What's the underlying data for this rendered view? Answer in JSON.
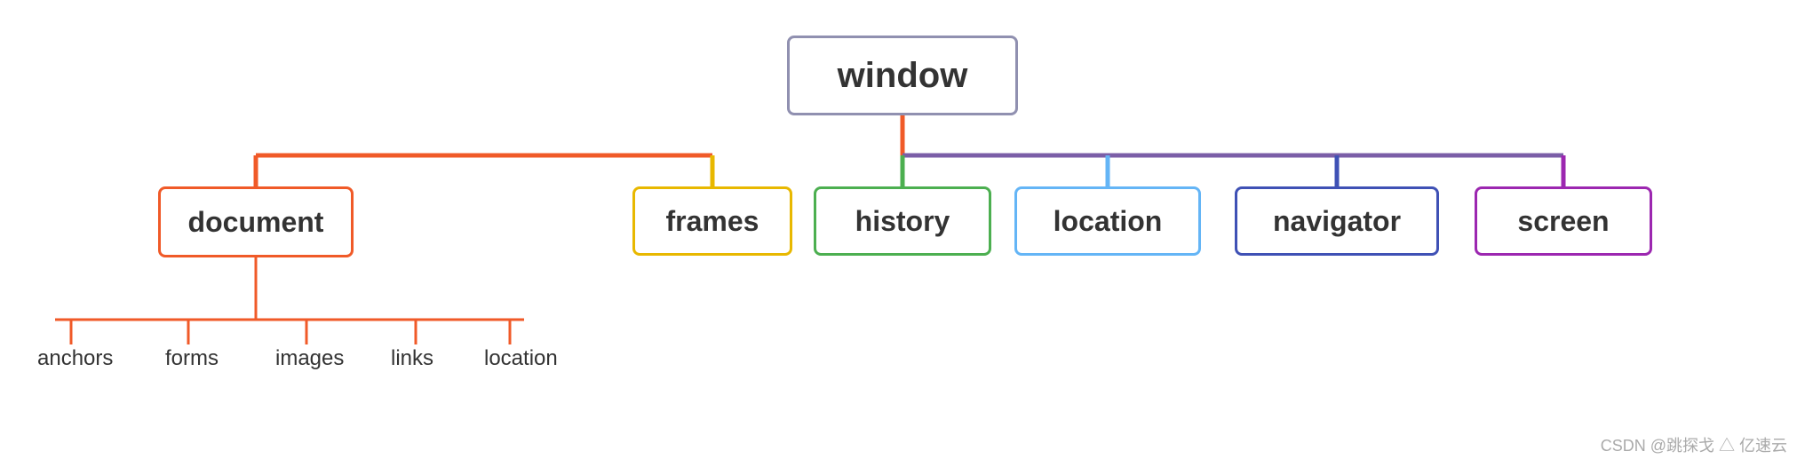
{
  "nodes": {
    "window": {
      "label": "window"
    },
    "document": {
      "label": "document"
    },
    "frames": {
      "label": "frames"
    },
    "history": {
      "label": "history"
    },
    "location": {
      "label": "location"
    },
    "navigator": {
      "label": "navigator"
    },
    "screen": {
      "label": "screen"
    }
  },
  "children": {
    "anchors": "anchors",
    "forms": "forms",
    "images": "images",
    "links": "links",
    "location_doc": "location"
  },
  "watermark": "CSDN @跳探戈  △ 亿速云"
}
